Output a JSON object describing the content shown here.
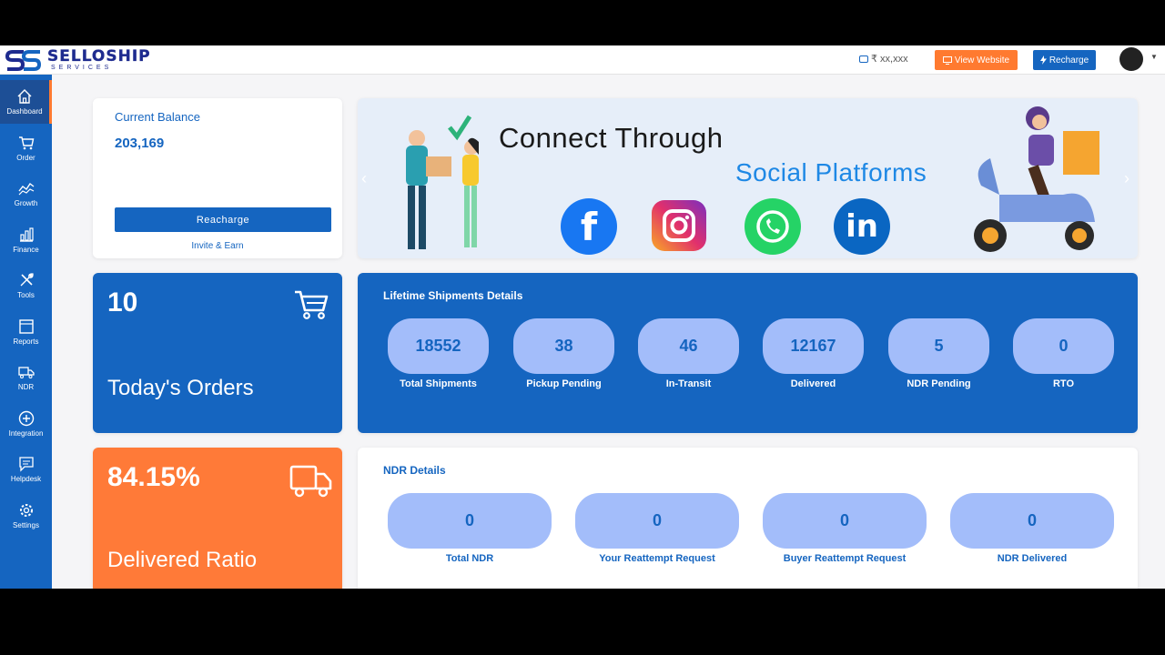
{
  "brand": {
    "name": "SELLOSHIP",
    "sub": "SERVICES"
  },
  "topbar": {
    "wallet": "₹ xx,xxx",
    "view_website": "View Website",
    "recharge": "Recharge"
  },
  "sidebar": {
    "items": [
      {
        "label": "Dashboard"
      },
      {
        "label": "Order"
      },
      {
        "label": "Growth"
      },
      {
        "label": "Finance"
      },
      {
        "label": "Tools"
      },
      {
        "label": "Reports"
      },
      {
        "label": "NDR"
      },
      {
        "label": "Integration"
      },
      {
        "label": "Helpdesk"
      },
      {
        "label": "Settings"
      }
    ]
  },
  "balance": {
    "label": "Current Balance",
    "value": "203,169",
    "button": "Reacharge",
    "invite": "Invite & Earn"
  },
  "banner": {
    "line1": "Connect Through",
    "line2": "Social Platforms"
  },
  "orders": {
    "value": "10",
    "label": "Today's Orders"
  },
  "ratio": {
    "value": "84.15%",
    "label": "Delivered Ratio"
  },
  "lifetime": {
    "title": "Lifetime Shipments Details",
    "stats": [
      {
        "value": "18552",
        "label": "Total Shipments"
      },
      {
        "value": "38",
        "label": "Pickup Pending"
      },
      {
        "value": "46",
        "label": "In-Transit"
      },
      {
        "value": "12167",
        "label": "Delivered"
      },
      {
        "value": "5",
        "label": "NDR Pending"
      },
      {
        "value": "0",
        "label": "RTO"
      }
    ]
  },
  "ndr": {
    "title": "NDR Details",
    "stats": [
      {
        "value": "0",
        "label": "Total NDR"
      },
      {
        "value": "0",
        "label": "Your Reattempt Request"
      },
      {
        "value": "0",
        "label": "Buyer Reattempt Request"
      },
      {
        "value": "0",
        "label": "NDR Delivered"
      }
    ]
  },
  "colors": {
    "primary": "#1565c0",
    "accent": "#ff7a30",
    "pill": "#a3bdfa"
  }
}
